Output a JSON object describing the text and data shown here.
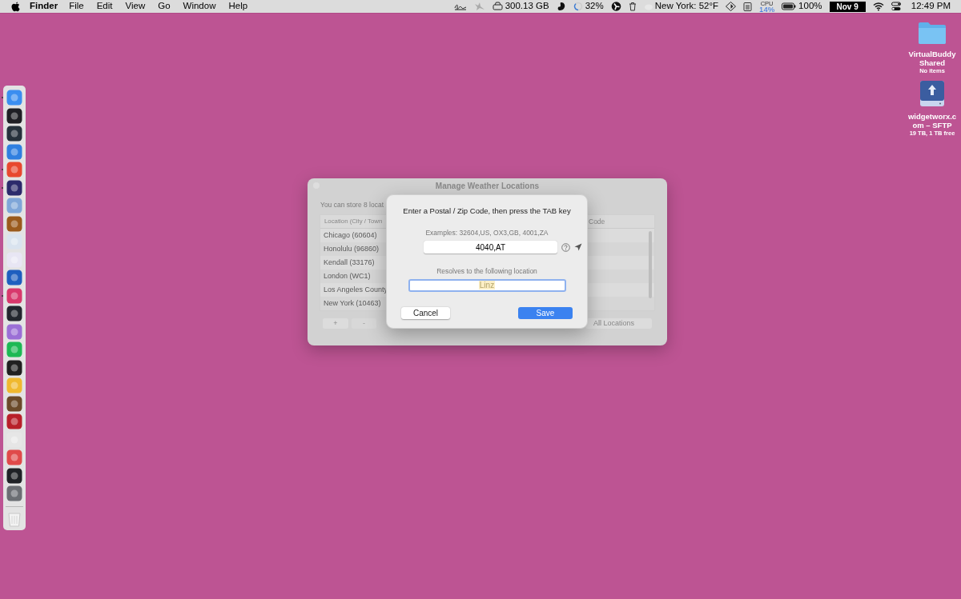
{
  "menu_bar": {
    "app": "Finder",
    "menus": [
      "File",
      "Edit",
      "View",
      "Go",
      "Window",
      "Help"
    ],
    "status": {
      "disk": "300.13 GB",
      "progress": "32%",
      "weather": "New York: 52°F",
      "cpu_label": "CPU",
      "cpu": "14%",
      "battery": "100%",
      "date": "Nov 9",
      "time": "12:49 PM"
    }
  },
  "desktop_items": [
    {
      "kind": "folder",
      "name": "VirtualBuddy Shared",
      "detail": "No items"
    },
    {
      "kind": "drive",
      "name": "widgetworx.com – SFTP",
      "detail": "19 TB, 1 TB free"
    }
  ],
  "dock": {
    "apps": [
      {
        "color": "#3b8ef0",
        "running": true
      },
      {
        "color": "#1f1f24",
        "running": false
      },
      {
        "color": "#26313b",
        "running": false
      },
      {
        "color": "#2f7fe0",
        "running": false
      },
      {
        "color": "#e8482f",
        "running": true
      },
      {
        "color": "#2b2a6b",
        "running": true
      },
      {
        "color": "#7fa6d8",
        "running": false
      },
      {
        "color": "#9a5a1c",
        "running": false
      },
      {
        "color": "#d9e3ef",
        "running": false
      },
      {
        "color": "#e8e6f4",
        "running": false
      },
      {
        "color": "#1e5fbf",
        "running": false
      },
      {
        "color": "#d8386c",
        "running": true
      },
      {
        "color": "#23262e",
        "running": false
      },
      {
        "color": "#9b6fd6",
        "running": false
      },
      {
        "color": "#1db954",
        "running": false
      },
      {
        "color": "#202020",
        "running": false
      },
      {
        "color": "#f0b92f",
        "running": false
      },
      {
        "color": "#6a4a2a",
        "running": false
      },
      {
        "color": "#b8202a",
        "running": false
      },
      {
        "color": "#e6e6e6",
        "running": false
      },
      {
        "color": "#e04a4a",
        "running": false
      },
      {
        "color": "#1f2226",
        "running": false
      },
      {
        "color": "#6b6e73",
        "running": false
      }
    ]
  },
  "window": {
    "title": "Manage Weather Locations",
    "intro": "You can store 8 locat",
    "columns": [
      "Location (City / Town",
      "Code"
    ],
    "rows": [
      "Chicago (60604)",
      "Honolulu (96860)",
      "Kendall (33176)",
      "London (WC1)",
      "Los Angeles County",
      "New York (10463)"
    ],
    "add_button": "+",
    "remove_button": "-",
    "all_button": "All Locations"
  },
  "sheet": {
    "prompt": "Enter a Postal / Zip Code, then press the TAB key",
    "examples": "Examples: 32604,US, OX3,GB, 4001,ZA",
    "code_value": "4040,AT",
    "resolves_label": "Resolves to the following location",
    "location_value": "Linz",
    "cancel": "Cancel",
    "save": "Save"
  }
}
